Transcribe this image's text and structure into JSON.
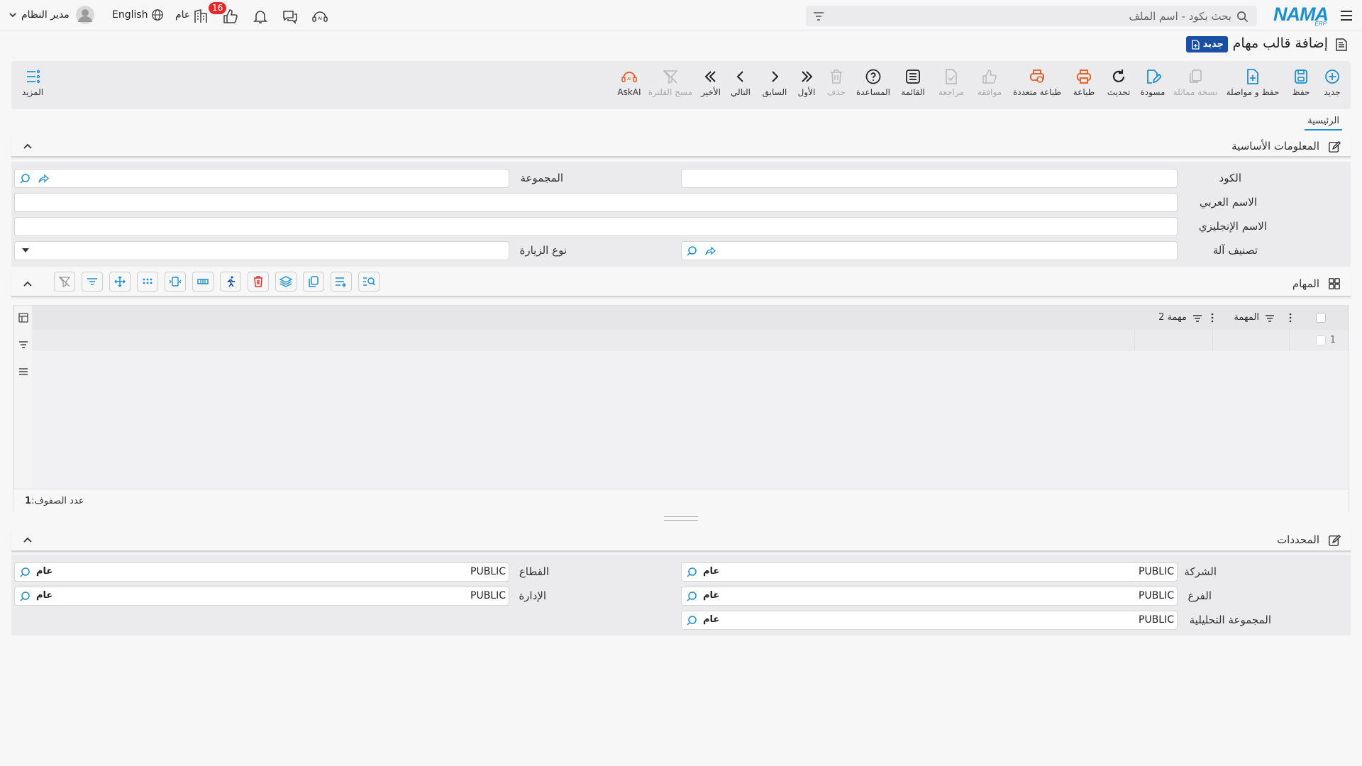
{
  "header": {
    "search_placeholder": "بحث بكود - اسم الملف",
    "notification_count": "16",
    "public_label": "عام",
    "language": "English",
    "user_name": "مدير النظام",
    "logo_main": "NAMA",
    "logo_sub": "ERP"
  },
  "page": {
    "title": "إضافة قالب مهام",
    "status_badge": "جديد"
  },
  "toolbar": {
    "new": "جديد",
    "save": "حفظ",
    "save_continue": "حفظ و مواصلة",
    "duplicate": "نسخة مماثلة",
    "draft": "مسودة",
    "refresh": "تحديث",
    "print": "طباعة",
    "multi_print": "طباعة متعددة",
    "approve": "موافقة",
    "review": "مراجعة",
    "list": "القائمة",
    "help": "المساعدة",
    "delete": "حذف",
    "first": "الأول",
    "previous": "السابق",
    "next": "التالي",
    "last": "الأخير",
    "clear_filter": "مسح الفلترة",
    "askai": "AskAI",
    "more": "المزيد"
  },
  "tabs": {
    "main": "الرئيسية"
  },
  "basic_info": {
    "title": "المعلومات الأساسية",
    "code_label": "الكود",
    "group_label": "المجموعة",
    "arabic_name_label": "الاسم العربي",
    "english_name_label": "الاسم الإنجليزي",
    "machine_class_label": "تصنيف آلة",
    "visit_type_label": "نوع الزيارة"
  },
  "tasks": {
    "title": "المهام",
    "columns": [
      "المهمة",
      "مهمة 2"
    ],
    "row_numbers": [
      "1"
    ],
    "row_count_label": "عدد الصفوف:",
    "row_count": "1"
  },
  "dimensions": {
    "title": "المحددات",
    "company_label": "الشركة",
    "sector_label": "القطاع",
    "branch_label": "الفرع",
    "department_label": "الإدارة",
    "analytic_group_label": "المجموعة التحليلية",
    "value": "PUBLIC",
    "value_name": "عام"
  },
  "colors": {
    "accent": "#1d8fd1",
    "badge": "#1b4fa3",
    "print": "#e8551f",
    "notify": "#e32929"
  }
}
